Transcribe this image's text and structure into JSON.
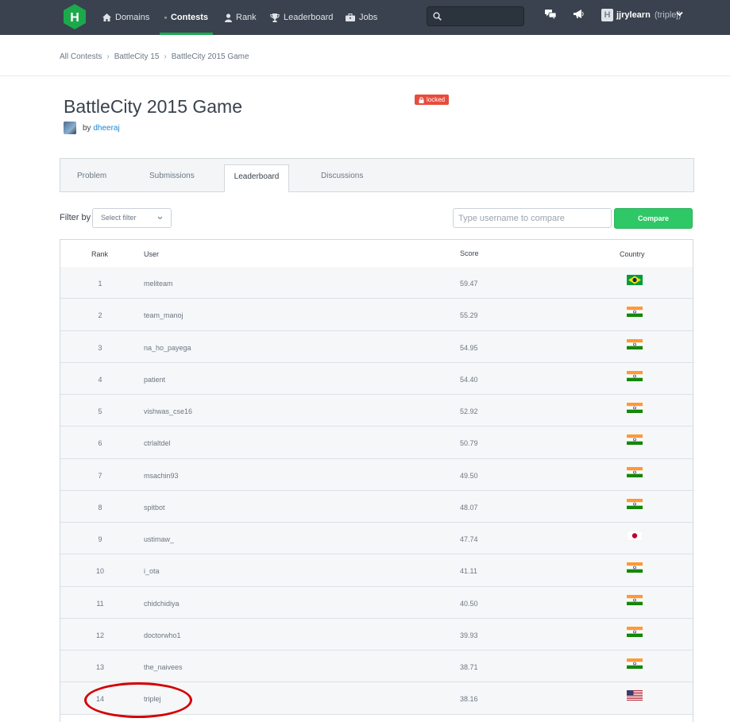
{
  "nav": {
    "items": [
      {
        "label": "Domains",
        "icon": "home-icon"
      },
      {
        "label": "Contests",
        "icon": "shield-icon",
        "active": true
      },
      {
        "label": "Rank",
        "icon": "person-icon"
      },
      {
        "label": "Leaderboard",
        "icon": "trophy-icon"
      },
      {
        "label": "Jobs",
        "icon": "briefcase-icon"
      }
    ],
    "search_placeholder": "",
    "username": "jjrylearn",
    "handle": "(triplej)",
    "avatar_letter": "H"
  },
  "breadcrumb": [
    "All Contests",
    "BattleCity 15",
    "BattleCity 2015 Game"
  ],
  "challenge": {
    "title": "BattleCity 2015 Game",
    "badge": "locked",
    "by_label": "by",
    "author": "dheeraj"
  },
  "tabs": [
    "Problem",
    "Submissions",
    "Leaderboard",
    "Discussions"
  ],
  "active_tab": "Leaderboard",
  "filter": {
    "label": "Filter by",
    "select_value": "Select filter"
  },
  "compare": {
    "placeholder": "Type username to compare",
    "button": "Compare"
  },
  "table": {
    "headers": {
      "rank": "Rank",
      "user": "User",
      "score": "Score",
      "country": "Country"
    },
    "rows": [
      {
        "rank": "1",
        "user": "meliteam",
        "score": "59.47",
        "country": "brazil"
      },
      {
        "rank": "2",
        "user": "team_manoj",
        "score": "55.29",
        "country": "india"
      },
      {
        "rank": "3",
        "user": "na_ho_payega",
        "score": "54.95",
        "country": "india"
      },
      {
        "rank": "4",
        "user": "patient",
        "score": "54.40",
        "country": "india"
      },
      {
        "rank": "5",
        "user": "vishwas_cse16",
        "score": "52.92",
        "country": "india"
      },
      {
        "rank": "6",
        "user": "ctrlaltdel",
        "score": "50.79",
        "country": "india"
      },
      {
        "rank": "7",
        "user": "msachin93",
        "score": "49.50",
        "country": "india"
      },
      {
        "rank": "8",
        "user": "spitbot",
        "score": "48.07",
        "country": "india"
      },
      {
        "rank": "9",
        "user": "ustimaw_",
        "score": "47.74",
        "country": "japan"
      },
      {
        "rank": "10",
        "user": "i_ota",
        "score": "41.11",
        "country": "india"
      },
      {
        "rank": "11",
        "user": "chidchidiya",
        "score": "40.50",
        "country": "india"
      },
      {
        "rank": "12",
        "user": "doctorwho1",
        "score": "39.93",
        "country": "india"
      },
      {
        "rank": "13",
        "user": "the_naivees",
        "score": "38.71",
        "country": "india"
      },
      {
        "rank": "14",
        "user": "triplej",
        "score": "38.16",
        "country": "usa",
        "highlighted": true
      }
    ]
  },
  "colors": {
    "nav_bg": "#39424e",
    "accent_green": "#2ec866",
    "active_underline": "#1ba94c",
    "badge_red": "#e74c3c",
    "link_blue": "#1d87d3",
    "highlight_circle": "#d40000"
  }
}
